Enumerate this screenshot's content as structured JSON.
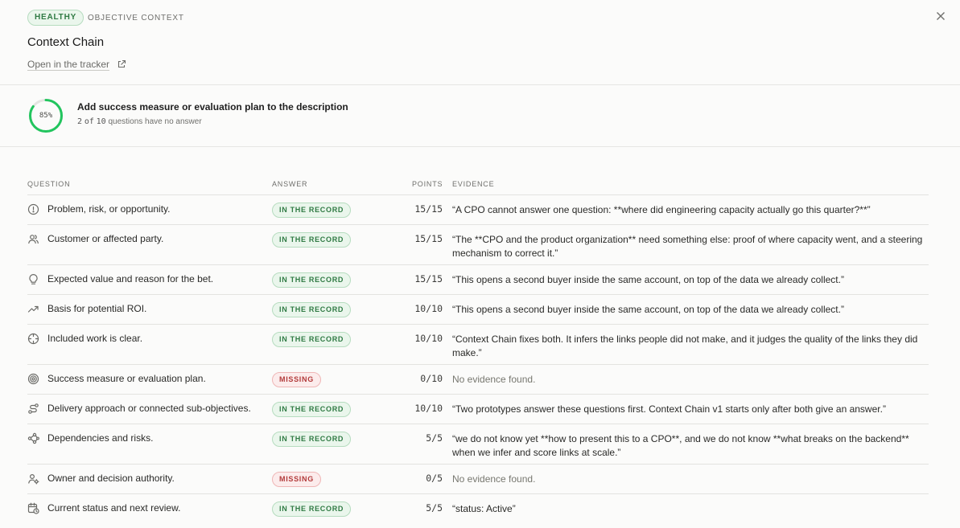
{
  "header": {
    "status_badge": "HEALTHY",
    "kicker": "OBJECTIVE CONTEXT",
    "title": "Context Chain",
    "tracker_link": "Open in the tracker",
    "colors": {
      "healthy": "#2f7a43",
      "missing": "#b23a3a",
      "ring": "#22c55e"
    }
  },
  "summary": {
    "score_label": "85%",
    "score_value": 85,
    "title": "Add success measure or evaluation plan to the description",
    "unanswered": "2",
    "of_word": "of",
    "total": "10",
    "suffix": "questions have no answer"
  },
  "table": {
    "columns": {
      "question": "QUESTION",
      "answer": "ANSWER",
      "points": "POINTS",
      "evidence": "EVIDENCE"
    },
    "rows": [
      {
        "icon": "alert-circle-icon",
        "question": "Problem, risk, or opportunity.",
        "answer": "IN THE RECORD",
        "status": "ok",
        "points": "15/15",
        "evidence": "“A CPO cannot answer one question: **where did engineering capacity actually go this quarter?**”"
      },
      {
        "icon": "users-icon",
        "question": "Customer or affected party.",
        "answer": "IN THE RECORD",
        "status": "ok",
        "points": "15/15",
        "evidence": "“The **CPO and the product organization** need something else: proof of where capacity went, and a steering mechanism to correct it.”"
      },
      {
        "icon": "lightbulb-icon",
        "question": "Expected value and reason for the bet.",
        "answer": "IN THE RECORD",
        "status": "ok",
        "points": "15/15",
        "evidence": "“This opens a second buyer inside the same account, on top of the data we already collect.”"
      },
      {
        "icon": "trending-up-icon",
        "question": "Basis for potential ROI.",
        "answer": "IN THE RECORD",
        "status": "ok",
        "points": "10/10",
        "evidence": "“This opens a second buyer inside the same account, on top of the data we already collect.”"
      },
      {
        "icon": "crosshair-icon",
        "question": "Included work is clear.",
        "answer": "IN THE RECORD",
        "status": "ok",
        "points": "10/10",
        "evidence": "“Context Chain fixes both. It infers the links people did not make, and it judges the quality of the links they did make.”"
      },
      {
        "icon": "target-icon",
        "question": "Success measure or evaluation plan.",
        "answer": "MISSING",
        "status": "miss",
        "points": "0/10",
        "evidence": "No evidence found."
      },
      {
        "icon": "route-icon",
        "question": "Delivery approach or connected sub-objectives.",
        "answer": "IN THE RECORD",
        "status": "ok",
        "points": "10/10",
        "evidence": "“Two prototypes answer these questions first. Context Chain v1 starts only after both give an answer.”"
      },
      {
        "icon": "network-icon",
        "question": "Dependencies and risks.",
        "answer": "IN THE RECORD",
        "status": "ok",
        "points": "5/5",
        "evidence": "“we do not know yet **how to present this to a CPO**, and we do not know **what breaks on the backend** when we infer and score links at scale.”"
      },
      {
        "icon": "user-settings-icon",
        "question": "Owner and decision authority.",
        "answer": "MISSING",
        "status": "miss",
        "points": "0/5",
        "evidence": "No evidence found."
      },
      {
        "icon": "calendar-clock-icon",
        "question": "Current status and next review.",
        "answer": "IN THE RECORD",
        "status": "ok",
        "points": "5/5",
        "evidence": "“status: Active”"
      }
    ]
  }
}
